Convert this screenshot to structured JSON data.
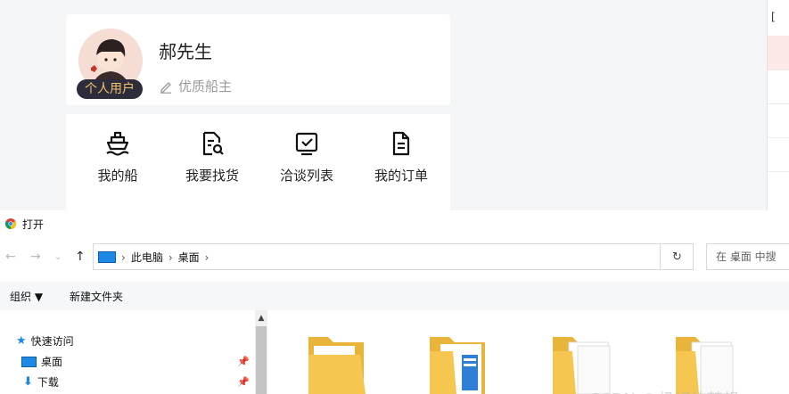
{
  "profile": {
    "name": "郝先生",
    "tag": "个人用户",
    "subtitle": "优质船主"
  },
  "menu": [
    {
      "label": "我的船",
      "icon": "ship-icon"
    },
    {
      "label": "我要找货",
      "icon": "cargo-search-icon"
    },
    {
      "label": "洽谈列表",
      "icon": "checkbox-icon"
    },
    {
      "label": "我的订单",
      "icon": "order-doc-icon"
    }
  ],
  "right_panel": {
    "header": "["
  },
  "dialog": {
    "title": "打开",
    "breadcrumb": [
      "此电脑",
      "桌面"
    ],
    "search_placeholder": "在 桌面 中搜",
    "toolbar": {
      "organize": "组织 ▼",
      "new_folder": "新建文件夹"
    },
    "nav": [
      {
        "label": "快速访问",
        "icon": "star-icon",
        "pinned": false
      },
      {
        "label": "桌面",
        "icon": "desktop-icon",
        "pinned": true
      },
      {
        "label": "下载",
        "icon": "download-icon",
        "pinned": true
      }
    ]
  },
  "watermark": "CSDN @极好的梦想",
  "colors": {
    "accent": "#1e88e5",
    "tag_bg": "#2c2c3a",
    "tag_text": "#f4c26a",
    "folder": "#f5c750"
  }
}
